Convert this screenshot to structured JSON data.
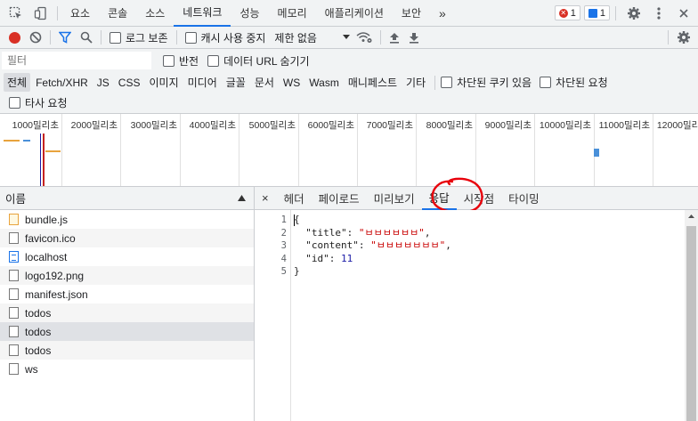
{
  "top_tabs": [
    "요소",
    "콘솔",
    "소스",
    "네트워크",
    "성능",
    "메모리",
    "애플리케이션",
    "보안"
  ],
  "more_tabs": "»",
  "error_count": "1",
  "message_count": "1",
  "toolbar": {
    "preserve_log": "로그 보존",
    "disable_cache": "캐시 사용 중지",
    "throttle": "제한 없음"
  },
  "filter": {
    "placeholder": "필터",
    "invert": "반전",
    "hide_data_urls": "데이터 URL 숨기기"
  },
  "types": [
    "전체",
    "Fetch/XHR",
    "JS",
    "CSS",
    "이미지",
    "미디어",
    "글꼴",
    "문서",
    "WS",
    "Wasm",
    "매니페스트",
    "기타"
  ],
  "blocked_cookies": "차단된 쿠키 있음",
  "blocked_requests": "차단된 요청",
  "third_party": "타사 요청",
  "timeline_ticks": [
    "1000밀리초",
    "2000밀리초",
    "3000밀리초",
    "4000밀리초",
    "5000밀리초",
    "6000밀리초",
    "7000밀리초",
    "8000밀리초",
    "9000밀리초",
    "10000밀리초",
    "11000밀리초",
    "12000밀리초"
  ],
  "list_header": "이름",
  "requests": [
    {
      "name": "bundle.js",
      "type": "js"
    },
    {
      "name": "favicon.ico",
      "type": "file"
    },
    {
      "name": "localhost",
      "type": "doc"
    },
    {
      "name": "logo192.png",
      "type": "file"
    },
    {
      "name": "manifest.json",
      "type": "file"
    },
    {
      "name": "todos",
      "type": "file"
    },
    {
      "name": "todos",
      "type": "file"
    },
    {
      "name": "todos",
      "type": "file"
    },
    {
      "name": "ws",
      "type": "file"
    }
  ],
  "detail_close": "×",
  "detail_tabs": [
    "헤더",
    "페이로드",
    "미리보기",
    "응답",
    "시작점",
    "타이밍"
  ],
  "active_detail_tab": 3,
  "response_lines": [
    {
      "num": "1",
      "text": "{"
    },
    {
      "num": "2",
      "key": "\"title\"",
      "value": "\"ㅂㅂㅂㅂㅂㅂ\"",
      "tail": ","
    },
    {
      "num": "3",
      "key": "\"content\"",
      "value": "\"ㅂㅂㅂㅂㅂㅂㅂ\"",
      "tail": ","
    },
    {
      "num": "4",
      "key": "\"id\"",
      "num_value": "11"
    },
    {
      "num": "5",
      "text": "}"
    }
  ],
  "colors": {
    "accent": "#1a73e8",
    "annotation": "#e8000b"
  }
}
